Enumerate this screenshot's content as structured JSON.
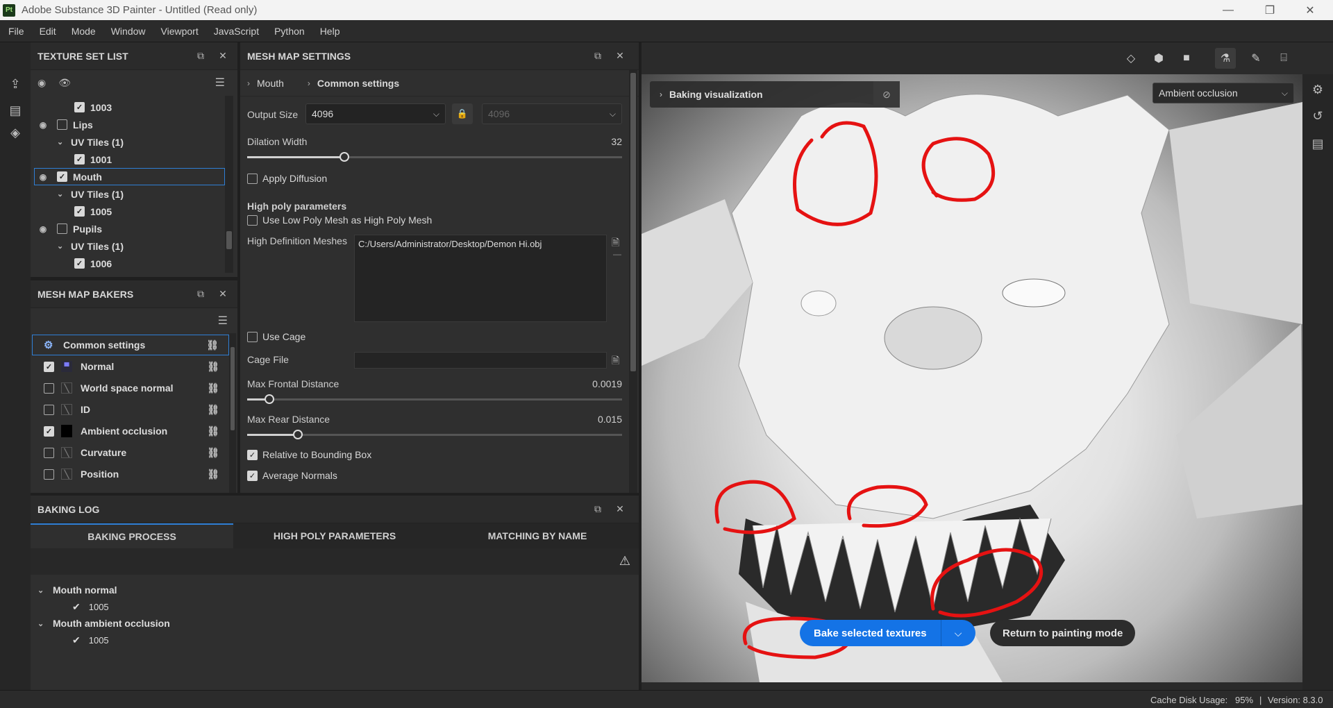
{
  "window": {
    "title": "Adobe Substance 3D Painter - Untitled (Read only)",
    "logo": "Pt"
  },
  "menu": [
    "File",
    "Edit",
    "Mode",
    "Window",
    "Viewport",
    "JavaScript",
    "Python",
    "Help"
  ],
  "texture_set_list": {
    "title": "TEXTURE SET LIST",
    "rows": [
      {
        "label": "1003",
        "level": 2,
        "checked": true,
        "eye": false
      },
      {
        "label": "Lips",
        "level": 0,
        "checked": false,
        "eye": true
      },
      {
        "label": "UV Tiles (1)",
        "level": 1,
        "checked": null,
        "eye": false
      },
      {
        "label": "1001",
        "level": 2,
        "checked": true,
        "eye": false
      },
      {
        "label": "Mouth",
        "level": 0,
        "checked": true,
        "eye": true,
        "selected": true
      },
      {
        "label": "UV Tiles (1)",
        "level": 1,
        "checked": null,
        "eye": false
      },
      {
        "label": "1005",
        "level": 2,
        "checked": true,
        "eye": false
      },
      {
        "label": "Pupils",
        "level": 0,
        "checked": false,
        "eye": true
      },
      {
        "label": "UV Tiles (1)",
        "level": 1,
        "checked": null,
        "eye": false
      },
      {
        "label": "1006",
        "level": 2,
        "checked": true,
        "eye": false
      }
    ]
  },
  "mesh_map_bakers": {
    "title": "MESH MAP BAKERS",
    "items": [
      {
        "label": "Common settings",
        "checked": null,
        "icon": "gear-icon",
        "selected": true
      },
      {
        "label": "Normal",
        "checked": true,
        "icon": "normal-map-icon"
      },
      {
        "label": "World space normal",
        "checked": false,
        "icon": "empty-thumb-icon"
      },
      {
        "label": "ID",
        "checked": false,
        "icon": "empty-thumb-icon"
      },
      {
        "label": "Ambient occlusion",
        "checked": true,
        "icon": "ao-thumb-icon"
      },
      {
        "label": "Curvature",
        "checked": false,
        "icon": "empty-thumb-icon"
      },
      {
        "label": "Position",
        "checked": false,
        "icon": "empty-thumb-icon"
      }
    ]
  },
  "mesh_map_settings": {
    "title": "MESH MAP SETTINGS",
    "breadcrumb": [
      "Mouth",
      "Common settings"
    ],
    "output_size_label": "Output Size",
    "output_size": "4096",
    "output_size_locked": "4096",
    "dilation_label": "Dilation Width",
    "dilation_value": "32",
    "dilation_fraction": 0.26,
    "apply_diffusion": "Apply Diffusion",
    "high_poly_header": "High poly parameters",
    "use_low_poly": "Use Low Poly Mesh as High Poly Mesh",
    "hd_meshes_label": "High Definition Meshes",
    "hd_meshes_value": "C:/Users/Administrator/Desktop/Demon Hi.obj",
    "use_cage": "Use Cage",
    "cage_file_label": "Cage File",
    "max_frontal_label": "Max Frontal Distance",
    "max_frontal_value": "0.0019",
    "max_frontal_fraction": 0.06,
    "max_rear_label": "Max Rear Distance",
    "max_rear_value": "0.015",
    "max_rear_fraction": 0.136,
    "relative_bbox": "Relative to Bounding Box",
    "average_normals": "Average Normals"
  },
  "baking_log": {
    "title": "BAKING LOG",
    "tabs": [
      "BAKING PROCESS",
      "HIGH POLY PARAMETERS",
      "MATCHING BY NAME"
    ],
    "entries": [
      {
        "name": "Mouth normal",
        "tile": "1005"
      },
      {
        "name": "Mouth ambient occlusion",
        "tile": "1005"
      }
    ]
  },
  "viewport": {
    "baking_visualization": "Baking visualization",
    "map_select": "Ambient occlusion",
    "bake_button": "Bake selected textures",
    "return_button": "Return to painting mode",
    "accent": "#1473e6"
  },
  "status": {
    "cache": "Cache Disk Usage:",
    "cache_value": "95%",
    "version": "Version: 8.3.0"
  }
}
